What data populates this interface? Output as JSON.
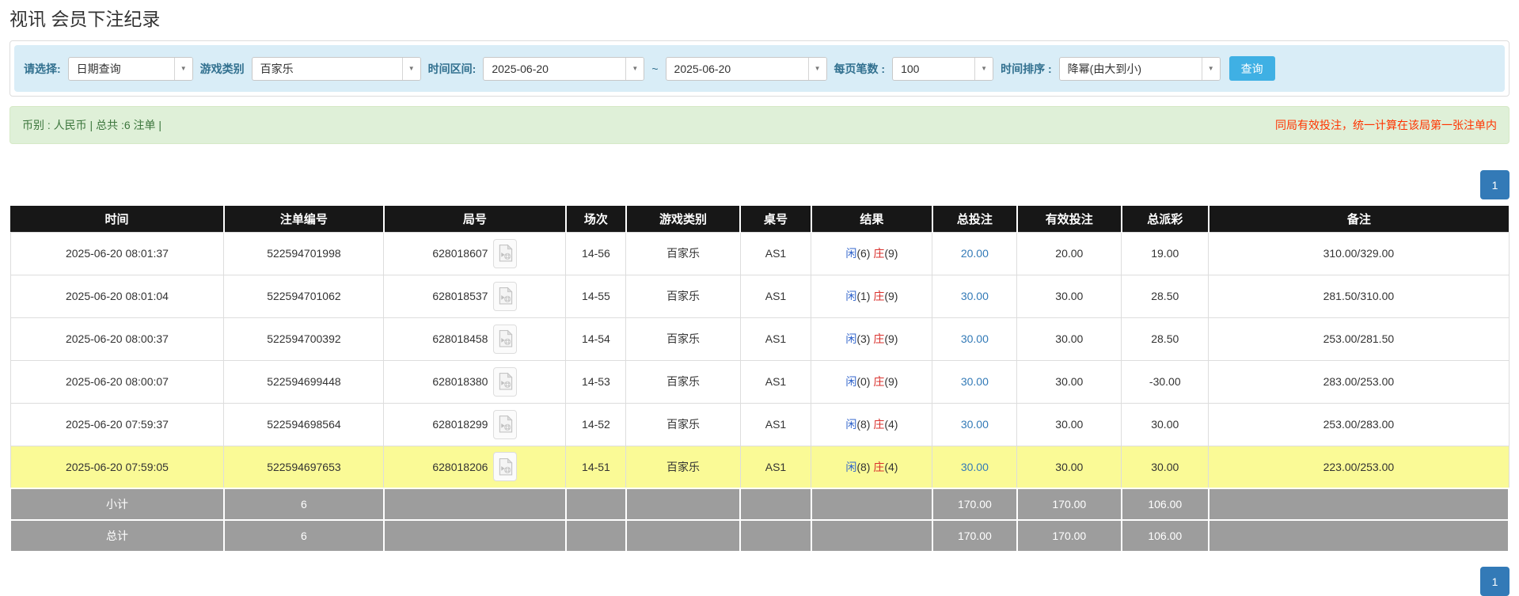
{
  "page": {
    "title": "视讯 会员下注纪录"
  },
  "icons": {
    "chevron_down": "▼"
  },
  "filters": {
    "select_label": "请选择:",
    "select_value": "日期查询",
    "game_type_label": "游戏类别",
    "game_type_value": "百家乐",
    "time_range_label": "时间区间:",
    "date_from": "2025-06-20",
    "range_separator": "~",
    "date_to": "2025-06-20",
    "page_size_label": "每页笔数 :",
    "page_size_value": "100",
    "sort_label": "时间排序 :",
    "sort_value": "降幂(由大到小)",
    "search_button": "查询"
  },
  "summary": {
    "left_text": "币别 : 人民币 | 总共 :6 注单 |",
    "right_note": "同局有效投注，统一计算在该局第一张注单内"
  },
  "pagination": {
    "page": "1"
  },
  "colors": {
    "accent_blue": "#337ab7",
    "search_button_blue": "#3fb0e4",
    "filter_bar_bg": "#d9edf7",
    "alert_green_bg": "#dff0d8",
    "header_black": "#171717",
    "footer_gray": "#9d9d9d",
    "highlight_yellow": "#fafa96",
    "player_blue": "#3366cc",
    "banker_red": "#d9302c",
    "negative_red": "#ff0000",
    "note_red": "#ff3300"
  },
  "table": {
    "headers": [
      "时间",
      "注单编号",
      "局号",
      "场次",
      "游戏类别",
      "桌号",
      "结果",
      "总投注",
      "有效投注",
      "总派彩",
      "备注"
    ],
    "rows": [
      {
        "time": "2025-06-20 08:01:37",
        "bet_id": "522594701998",
        "round_id": "628018607",
        "session": "14-56",
        "game_type": "百家乐",
        "table_no": "AS1",
        "player_label": "闲",
        "player_score": "(6)",
        "banker_label": "庄",
        "banker_score": "(9)",
        "total_bet": "20.00",
        "valid_bet": "20.00",
        "payout": "19.00",
        "remark": "310.00/329.00",
        "highlight": false
      },
      {
        "time": "2025-06-20 08:01:04",
        "bet_id": "522594701062",
        "round_id": "628018537",
        "session": "14-55",
        "game_type": "百家乐",
        "table_no": "AS1",
        "player_label": "闲",
        "player_score": "(1)",
        "banker_label": "庄",
        "banker_score": "(9)",
        "total_bet": "30.00",
        "valid_bet": "30.00",
        "payout": "28.50",
        "remark": "281.50/310.00",
        "highlight": false
      },
      {
        "time": "2025-06-20 08:00:37",
        "bet_id": "522594700392",
        "round_id": "628018458",
        "session": "14-54",
        "game_type": "百家乐",
        "table_no": "AS1",
        "player_label": "闲",
        "player_score": "(3)",
        "banker_label": "庄",
        "banker_score": "(9)",
        "total_bet": "30.00",
        "valid_bet": "30.00",
        "payout": "28.50",
        "remark": "253.00/281.50",
        "highlight": false
      },
      {
        "time": "2025-06-20 08:00:07",
        "bet_id": "522594699448",
        "round_id": "628018380",
        "session": "14-53",
        "game_type": "百家乐",
        "table_no": "AS1",
        "player_label": "闲",
        "player_score": "(0)",
        "banker_label": "庄",
        "banker_score": "(9)",
        "total_bet": "30.00",
        "valid_bet": "30.00",
        "payout": "-30.00",
        "remark": "283.00/253.00",
        "highlight": false
      },
      {
        "time": "2025-06-20 07:59:37",
        "bet_id": "522594698564",
        "round_id": "628018299",
        "session": "14-52",
        "game_type": "百家乐",
        "table_no": "AS1",
        "player_label": "闲",
        "player_score": "(8)",
        "banker_label": "庄",
        "banker_score": "(4)",
        "total_bet": "30.00",
        "valid_bet": "30.00",
        "payout": "30.00",
        "remark": "253.00/283.00",
        "highlight": false
      },
      {
        "time": "2025-06-20 07:59:05",
        "bet_id": "522594697653",
        "round_id": "628018206",
        "session": "14-51",
        "game_type": "百家乐",
        "table_no": "AS1",
        "player_label": "闲",
        "player_score": "(8)",
        "banker_label": "庄",
        "banker_score": "(4)",
        "total_bet": "30.00",
        "valid_bet": "30.00",
        "payout": "30.00",
        "remark": "223.00/253.00",
        "highlight": true
      }
    ],
    "footer": [
      {
        "label": "小计",
        "count": "6",
        "total_bet": "170.00",
        "valid_bet": "170.00",
        "payout": "106.00"
      },
      {
        "label": "总计",
        "count": "6",
        "total_bet": "170.00",
        "valid_bet": "170.00",
        "payout": "106.00"
      }
    ]
  }
}
